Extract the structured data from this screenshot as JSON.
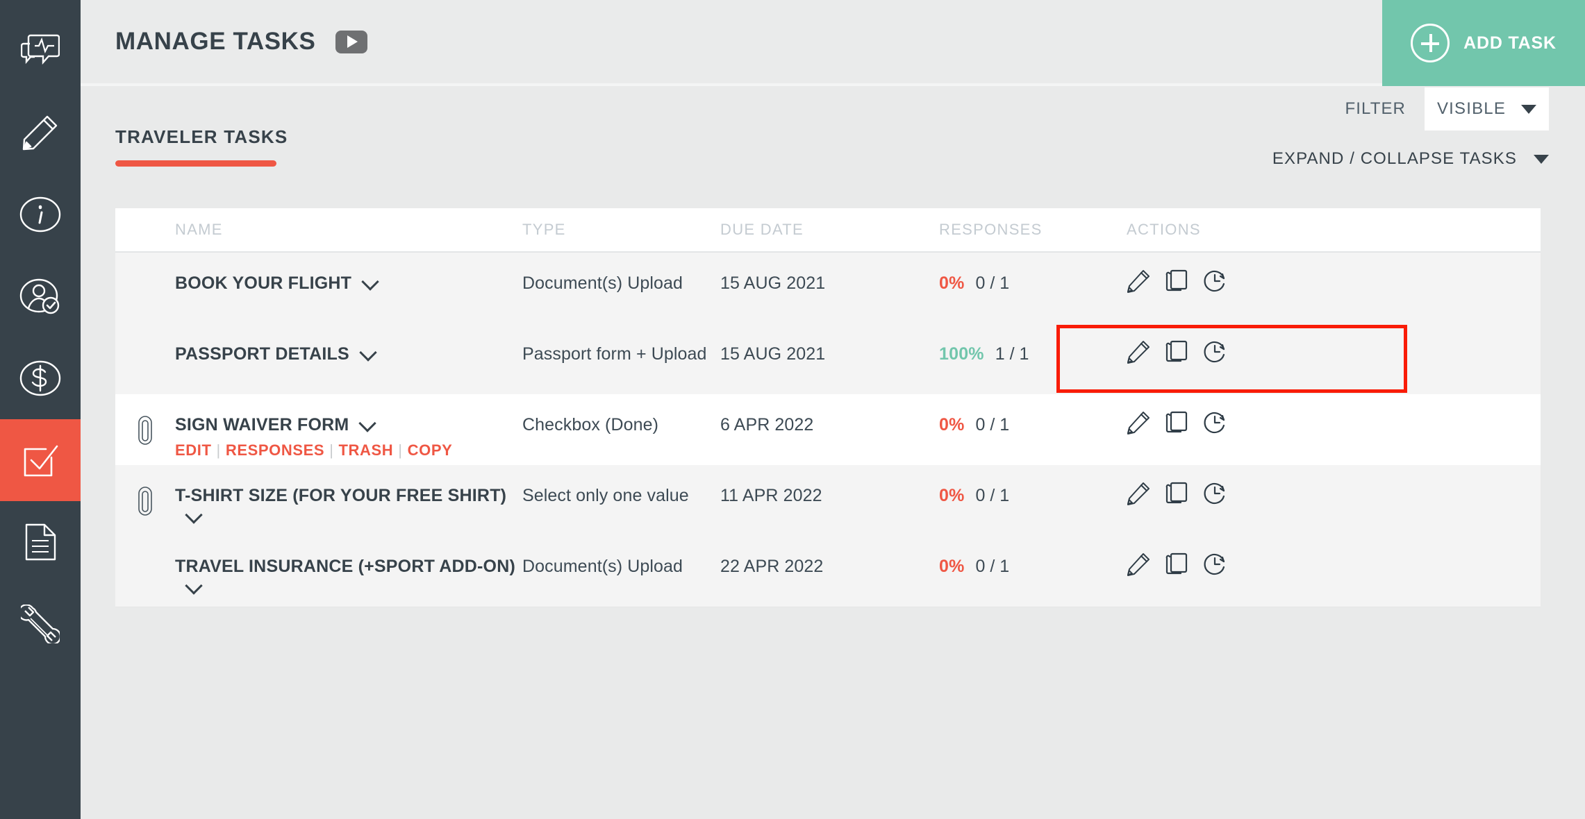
{
  "colors": {
    "sidebar_bg": "#37424a",
    "accent_red": "#ef5744",
    "accent_green": "#72c6ac",
    "highlight": "#f91c07",
    "page_bg": "#e9eaea",
    "header_muted": "#c4cbd1"
  },
  "sidebar": {
    "items": [
      {
        "icon": "chat-activity-icon",
        "name": "sidebar-item-messages",
        "active": false
      },
      {
        "icon": "pencil-icon",
        "name": "sidebar-item-edit",
        "active": false
      },
      {
        "icon": "info-circle-icon",
        "name": "sidebar-item-info",
        "active": false
      },
      {
        "icon": "user-check-icon",
        "name": "sidebar-item-travelers",
        "active": false
      },
      {
        "icon": "dollar-circle-icon",
        "name": "sidebar-item-payments",
        "active": false
      },
      {
        "icon": "checkbox-icon",
        "name": "sidebar-item-tasks",
        "active": true
      },
      {
        "icon": "document-icon",
        "name": "sidebar-item-documents",
        "active": false
      },
      {
        "icon": "wrench-icon",
        "name": "sidebar-item-settings",
        "active": false
      }
    ]
  },
  "header": {
    "title": "MANAGE TASKS",
    "video_icon": "play-button-icon",
    "add_task_label": "ADD TASK",
    "add_task_icon": "plus-circle-icon"
  },
  "tabs": {
    "active_label": "TRAVELER TASKS"
  },
  "controls": {
    "filter_label": "FILTER",
    "filter_value": "VISIBLE",
    "filter_caret": "chevron-down-icon",
    "expand_label": "EXPAND / COLLAPSE TASKS",
    "expand_caret": "chevron-down-icon"
  },
  "table": {
    "columns": [
      "NAME",
      "TYPE",
      "DUE DATE",
      "RESPONSES",
      "ACTIONS"
    ],
    "action_icons": [
      "pencil-icon",
      "copy-icon",
      "clock-history-icon"
    ],
    "rows": [
      {
        "attachment": false,
        "name": "BOOK YOUR FLIGHT",
        "type": "Document(s) Upload",
        "due_date": "15 AUG 2021",
        "percent": "0%",
        "percent_state": "zero",
        "ratio": "0 / 1",
        "sublinks": [],
        "shade": "gray",
        "highlighted": false
      },
      {
        "attachment": false,
        "name": "PASSPORT DETAILS",
        "type": "Passport form + Upload",
        "due_date": "15 AUG 2021",
        "percent": "100%",
        "percent_state": "full",
        "ratio": "1 / 1",
        "sublinks": [],
        "shade": "gray",
        "highlighted": true
      },
      {
        "attachment": true,
        "name": "SIGN WAIVER FORM",
        "type": "Checkbox (Done)",
        "due_date": "6 APR 2022",
        "percent": "0%",
        "percent_state": "zero",
        "ratio": "0 / 1",
        "sublinks": [
          "EDIT",
          "RESPONSES",
          "TRASH",
          "COPY"
        ],
        "shade": "white",
        "highlighted": false
      },
      {
        "attachment": true,
        "name": "T-SHIRT SIZE (FOR YOUR FREE SHIRT)",
        "type": "Select only one value",
        "due_date": "11 APR 2022",
        "percent": "0%",
        "percent_state": "zero",
        "ratio": "0 / 1",
        "sublinks": [],
        "shade": "gray",
        "highlighted": false
      },
      {
        "attachment": false,
        "name": "TRAVEL INSURANCE (+SPORT ADD-ON)",
        "type": "Document(s) Upload",
        "due_date": "22 APR 2022",
        "percent": "0%",
        "percent_state": "zero",
        "ratio": "0 / 1",
        "sublinks": [],
        "shade": "gray",
        "highlighted": false
      }
    ]
  }
}
